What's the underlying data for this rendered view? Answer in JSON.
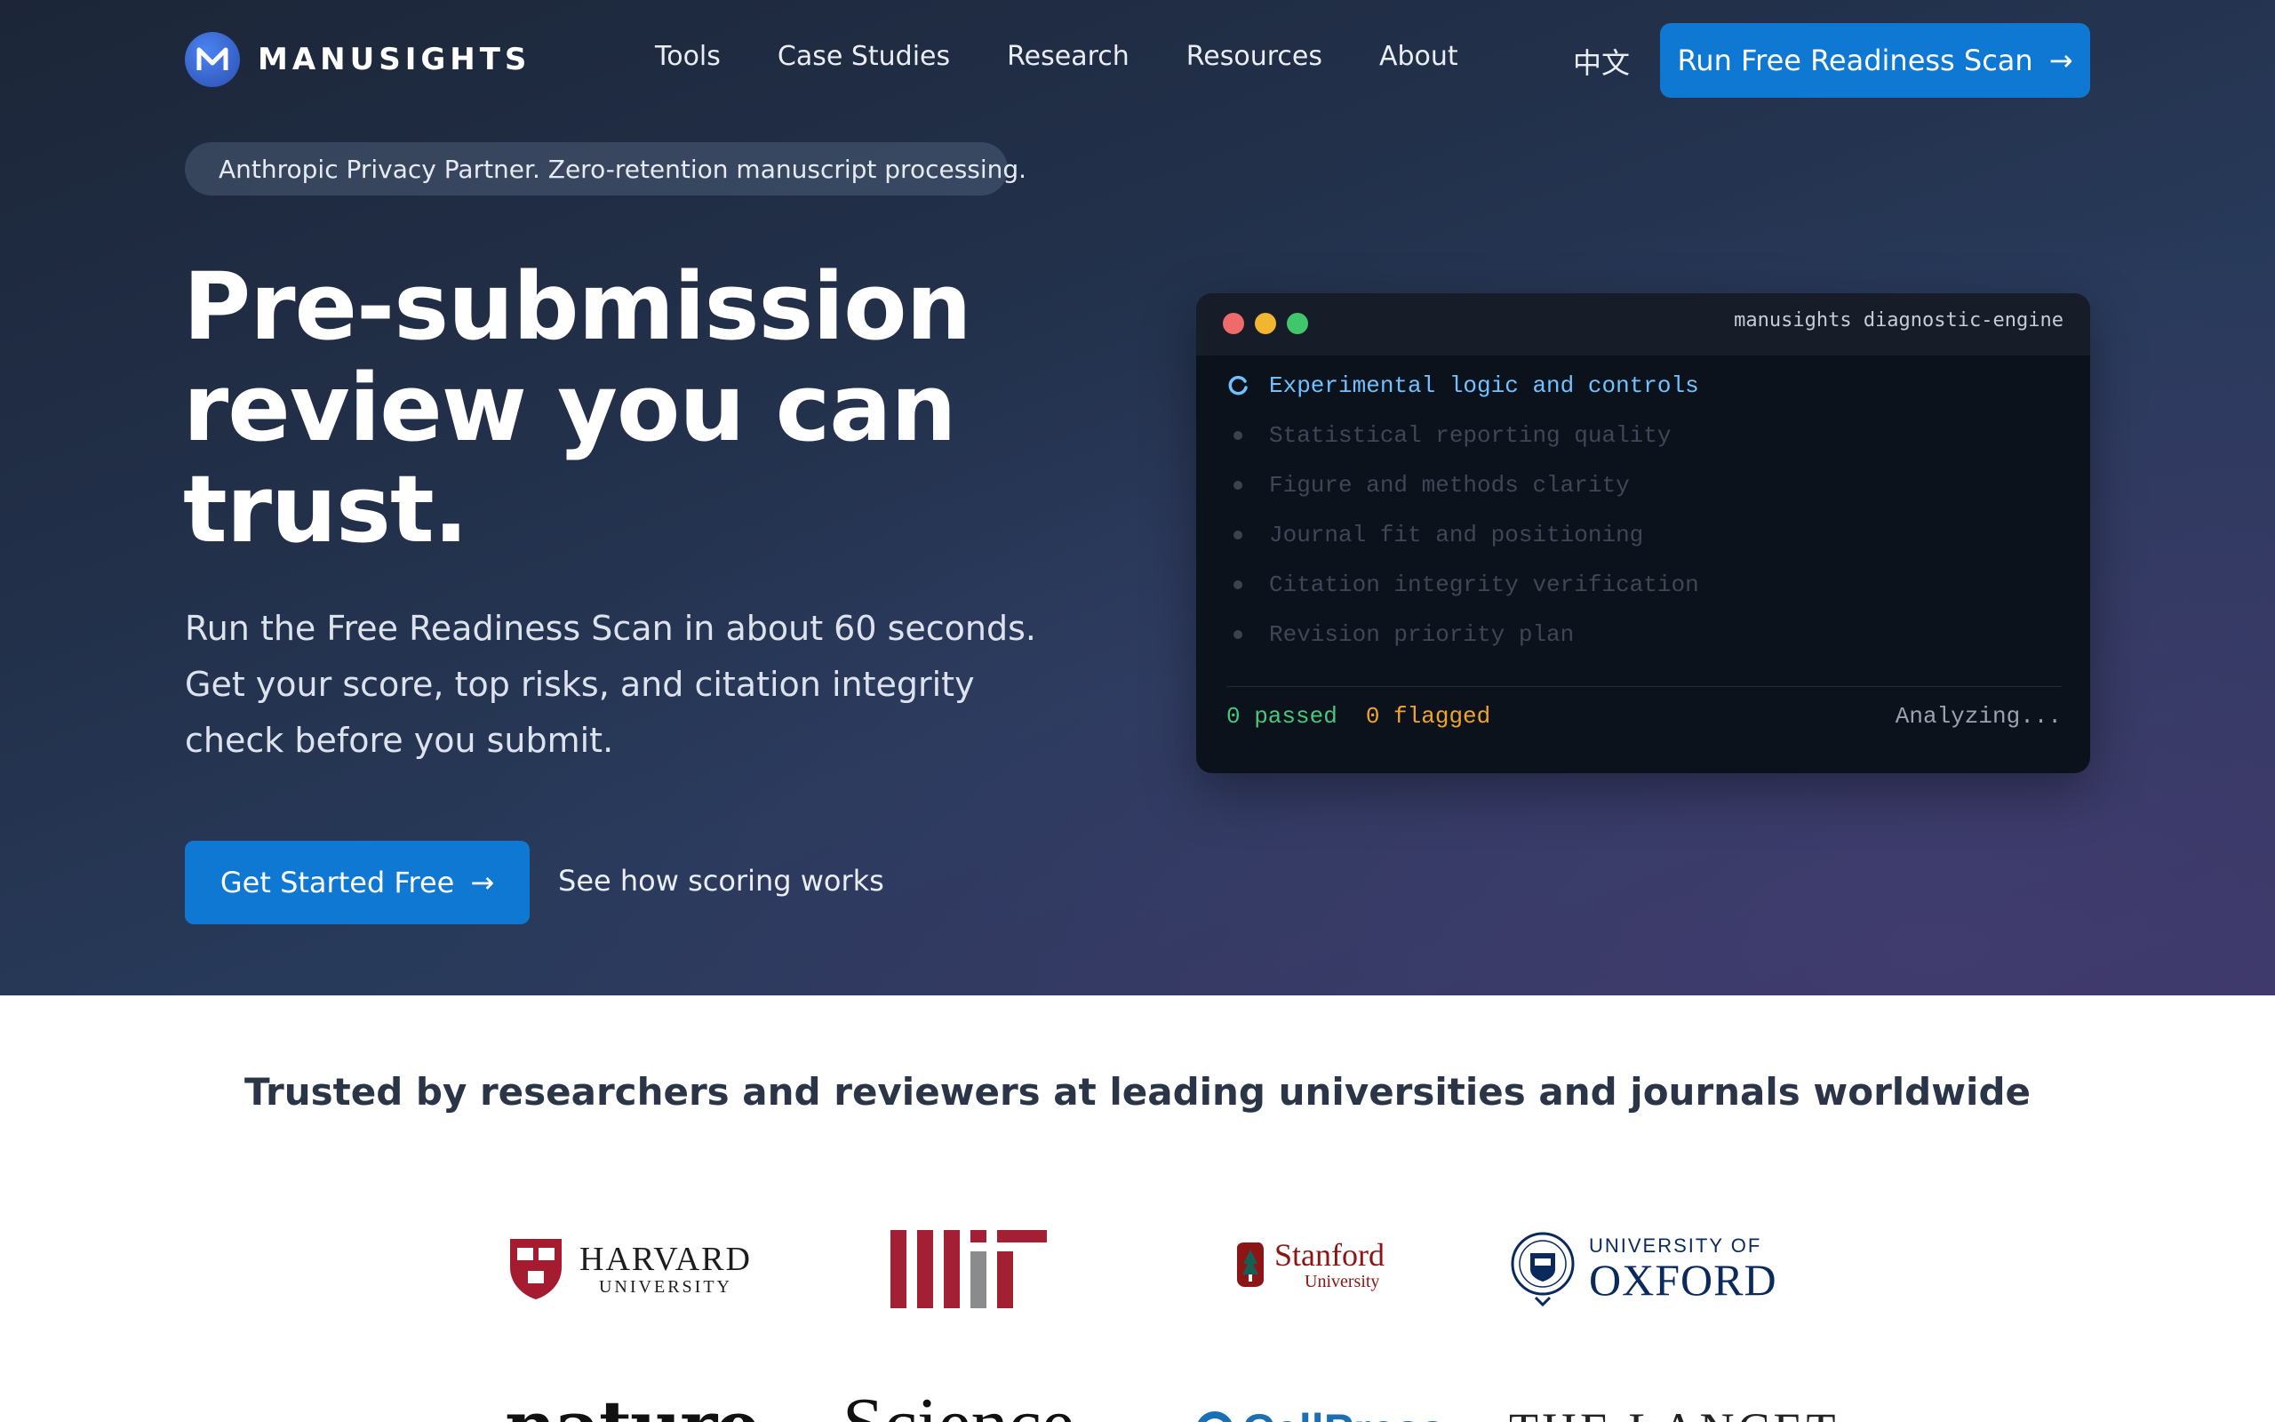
{
  "brand": {
    "name": "MANUSIGHTS"
  },
  "nav": {
    "items": [
      "Tools",
      "Case Studies",
      "Research",
      "Resources",
      "About"
    ],
    "language": "中文",
    "cta": "Run Free Readiness Scan",
    "cta_arrow": "→"
  },
  "hero": {
    "badge": "Anthropic Privacy Partner. Zero-retention manuscript processing.",
    "headline_line1": "Pre-submission",
    "headline_line2": "review you can",
    "headline_line3": "trust.",
    "subtext": "Run the Free Readiness Scan in about 60 seconds. Get your score, top risks, and citation integrity check before you submit.",
    "primary_cta": "Get Started Free",
    "primary_cta_arrow": "→",
    "secondary_link": "See how scoring works"
  },
  "terminal": {
    "title": "manusights diagnostic-engine",
    "items": [
      {
        "label": "Experimental logic and controls",
        "state": "active"
      },
      {
        "label": "Statistical reporting quality",
        "state": "pending"
      },
      {
        "label": "Figure and methods clarity",
        "state": "pending"
      },
      {
        "label": "Journal fit and positioning",
        "state": "pending"
      },
      {
        "label": "Citation integrity verification",
        "state": "pending"
      },
      {
        "label": "Revision priority plan",
        "state": "pending"
      }
    ],
    "passed": "0 passed",
    "flagged": "0 flagged",
    "status": "Analyzing..."
  },
  "trusted": {
    "title": "Trusted by researchers and reviewers at leading universities and journals worldwide",
    "logos": {
      "harvard_1": "HARVARD",
      "harvard_2": "UNIVERSITY",
      "mit": "MIT",
      "stanford_1": "Stanford",
      "stanford_2": "University",
      "oxford_1": "UNIVERSITY OF",
      "oxford_2": "OXFORD",
      "nature": "nature",
      "science": "Science",
      "cellpress": "CellPress",
      "lancet": "THE LANCET"
    }
  },
  "colors": {
    "accent": "#0e78d2",
    "active_item": "#6fc2ff",
    "passed": "#48c67a",
    "flagged": "#f0a52a",
    "harvard": "#a51c30",
    "stanford": "#8c1515",
    "oxford": "#0a2a5c"
  }
}
